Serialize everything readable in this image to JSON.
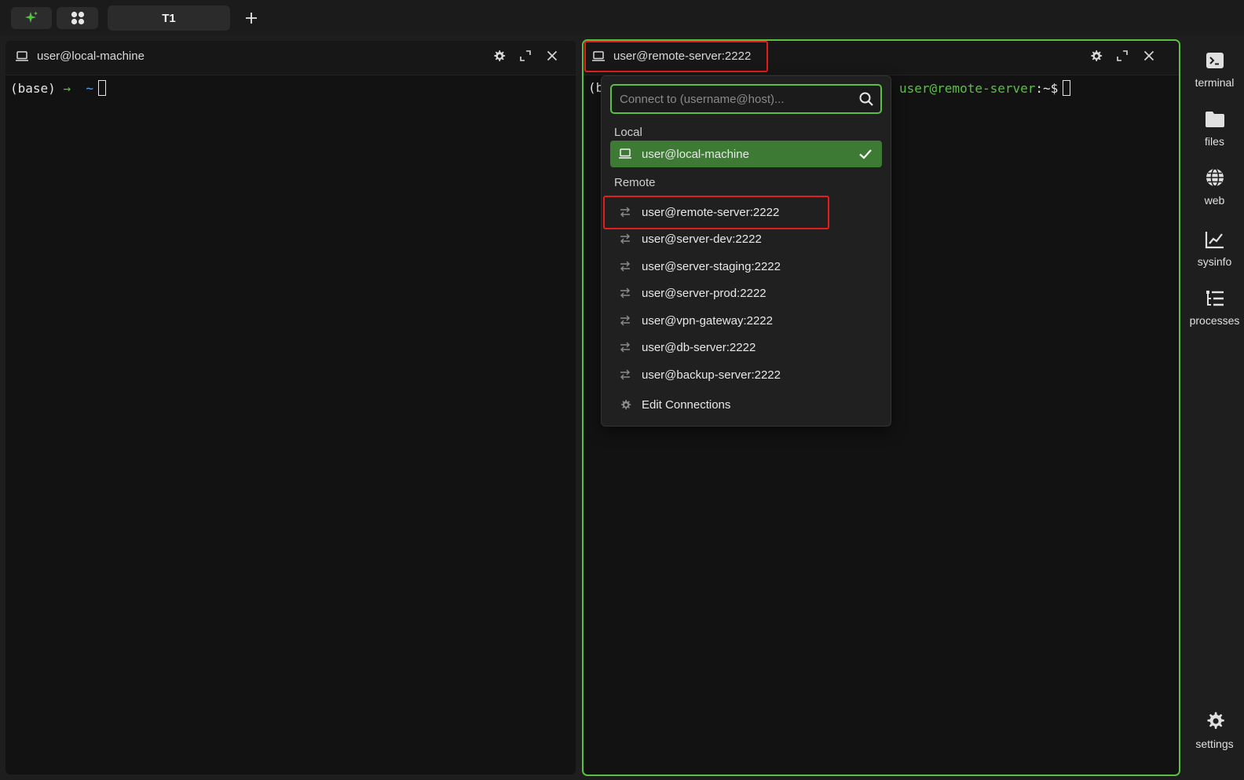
{
  "topbar": {
    "tab_label": "T1",
    "logo_icon": "sparkle-icon",
    "workspace_icon": "grid-icon",
    "add_icon": "plus-icon",
    "accent_color": "#58c142"
  },
  "left_pane": {
    "title": "user@local-machine",
    "prompt_prefix": "(base)",
    "prompt_arrow": "→",
    "prompt_dir": "~"
  },
  "right_pane": {
    "title": "user@remote-server:2222",
    "prompt_partial": "(b",
    "prompt_host": "user@remote-server",
    "prompt_path": ":~$"
  },
  "dropdown": {
    "search_placeholder": "Connect to (username@host)...",
    "local_label": "Local",
    "local_items": [
      {
        "label": "user@local-machine",
        "selected": true
      }
    ],
    "remote_label": "Remote",
    "remote_items": [
      {
        "label": "user@remote-server:2222"
      },
      {
        "label": "user@server-dev:2222"
      },
      {
        "label": "user@server-staging:2222"
      },
      {
        "label": "user@server-prod:2222"
      },
      {
        "label": "user@vpn-gateway:2222"
      },
      {
        "label": "user@db-server:2222"
      },
      {
        "label": "user@backup-server:2222"
      }
    ],
    "edit_label": "Edit Connections"
  },
  "sidebar": {
    "items": [
      {
        "label": "terminal",
        "icon": "terminal-icon"
      },
      {
        "label": "files",
        "icon": "folder-icon"
      },
      {
        "label": "web",
        "icon": "globe-icon"
      },
      {
        "label": "sysinfo",
        "icon": "chart-icon"
      },
      {
        "label": "processes",
        "icon": "list-icon"
      }
    ],
    "settings_label": "settings"
  }
}
